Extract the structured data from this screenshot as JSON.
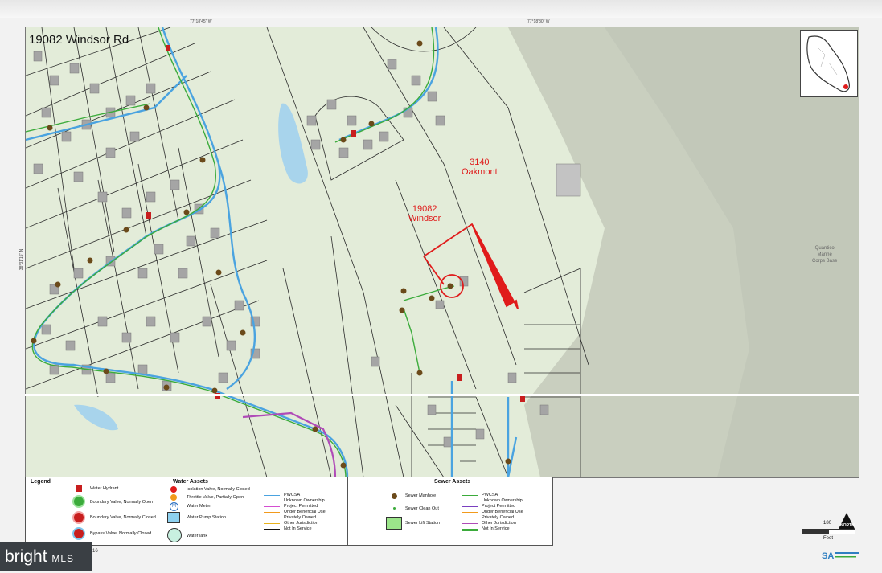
{
  "map": {
    "title": "19082 Windsor Rd",
    "coord_top_left": "77°18'45\" W",
    "coord_top_right": "77°18'30\" W",
    "coord_left": "38°31'15\" N",
    "parcel_subject": {
      "line1": "19082",
      "line2": "Windsor"
    },
    "parcel_neighbor": {
      "line1": "3140",
      "line2": "Oakmont"
    },
    "region_label": {
      "line1": "Quantico",
      "line2": "Marine",
      "line3": "Corps Base"
    },
    "colors": {
      "subject": "#e01b1b",
      "sewer": "#3bab3b",
      "water": "#4aa3e0",
      "lot_lines": "#2b2b2b",
      "terrain": "#e3ecd9"
    }
  },
  "legend": {
    "title": "Legend",
    "water_hydrant": "Water Hydrant",
    "boundary_open": "Boundary Valve, Normally Open",
    "boundary_closed": "Boundary Valve, Normally Closed",
    "bypass_closed": "Bypass Valve, Normally Closed",
    "water_assets_title": "Water Assets",
    "isolation_valve": "Isolation Valve, Normally Closed",
    "throttle_valve": "Throttle Valve, Partially Open",
    "water_meter": "Water Meter",
    "water_pump": "Water Pump Station",
    "water_tank": "WaterTank",
    "water_lines": [
      "PWCSA",
      "Unknown Ownership",
      "Project Permitted",
      "Under Beneficial Use",
      "Privately Owned",
      "Other Jurisdiction",
      "Not In Service"
    ],
    "sewer_assets_title": "Sewer Assets",
    "sewer_manhole": "Sewer Manhole",
    "sewer_clean_out": "Sewer Clean Out",
    "sewer_lift": "Sewer Lift Station",
    "sewer_lines": [
      "PWCSA",
      "Unknown Ownership",
      "Project Permitted",
      "Under Beneficial Use",
      "Privately Owned",
      "Other Jurisdiction",
      "Not In Service"
    ]
  },
  "scale": {
    "value": "180",
    "unit": "Feet"
  },
  "north_label": "NORTH",
  "page_number": "16",
  "watermark": {
    "brand": "bright",
    "suffix": "MLS"
  }
}
